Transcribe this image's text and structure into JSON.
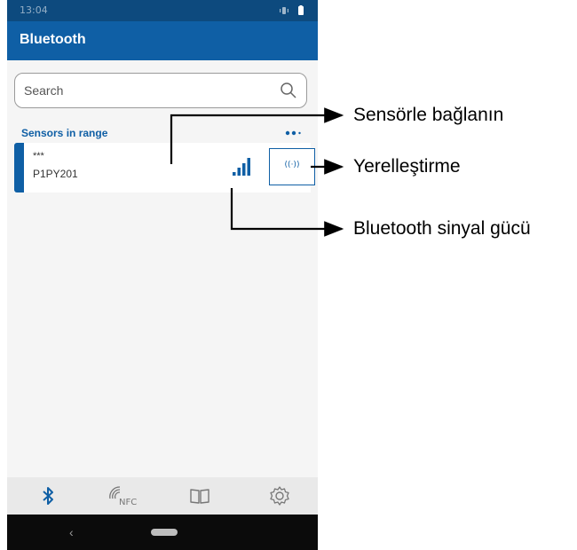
{
  "status_bar": {
    "time": "13:04"
  },
  "app_bar": {
    "title": "Bluetooth"
  },
  "search": {
    "placeholder": "Search"
  },
  "section": {
    "title": "Sensors in range"
  },
  "sensor": {
    "code": "***",
    "name": "P1PY201",
    "locate_label": "((·))"
  },
  "bottom_nav": {
    "items": [
      "bluetooth-icon",
      "nfc-icon",
      "book-icon",
      "settings-gear-icon"
    ],
    "nfc_text": "NFC"
  },
  "callouts": {
    "connect": "Sensörle bağlanın",
    "locate": "Yerelleştirme",
    "signal": "Bluetooth sinyal gücü"
  },
  "colors": {
    "primary": "#0f5fa5",
    "status_bar": "#0d4a7e"
  }
}
